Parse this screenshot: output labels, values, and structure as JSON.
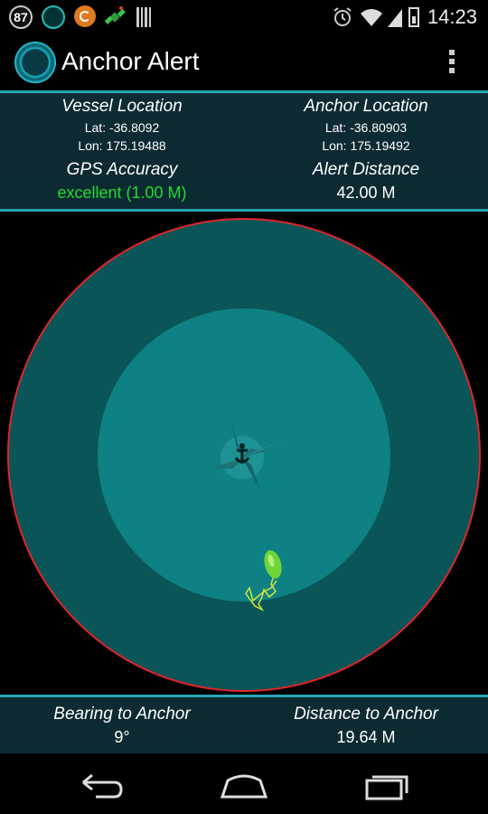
{
  "status_bar": {
    "notification_count": "87",
    "time": "14:23",
    "icons": [
      "app-notification-icon",
      "sync-icon",
      "satellite-icon",
      "barcode-icon",
      "alarm-icon",
      "wifi-icon",
      "signal-icon",
      "battery-icon"
    ]
  },
  "action_bar": {
    "title": "Anchor Alert",
    "overflow_icon": "overflow-menu-icon"
  },
  "info": {
    "vessel": {
      "label": "Vessel Location",
      "lat": "Lat: -36.8092",
      "lon": "Lon: 175.19488"
    },
    "anchor": {
      "label": "Anchor Location",
      "lat": "Lat: -36.80903",
      "lon": "Lon: 175.19492"
    },
    "gps": {
      "label": "GPS Accuracy",
      "value": "excellent (1.00 M)",
      "color": "#22dd33"
    },
    "alert": {
      "label": "Alert Distance",
      "value": "42.00 M"
    }
  },
  "map": {
    "outer_ring_color": "#e0262a",
    "outer_fill": "#0a5557",
    "inner_fill": "#0d8183",
    "track_color": "#d7e23a",
    "vessel_color": "#6fd33a",
    "icons": [
      "compass-rose-icon",
      "anchor-icon",
      "boat-icon"
    ]
  },
  "bottom": {
    "bearing": {
      "label": "Bearing to Anchor",
      "value": "9°"
    },
    "distance": {
      "label": "Distance to Anchor",
      "value": "19.64 M"
    }
  },
  "nav": {
    "icons": [
      "back-icon",
      "home-icon",
      "recent-apps-icon"
    ]
  }
}
